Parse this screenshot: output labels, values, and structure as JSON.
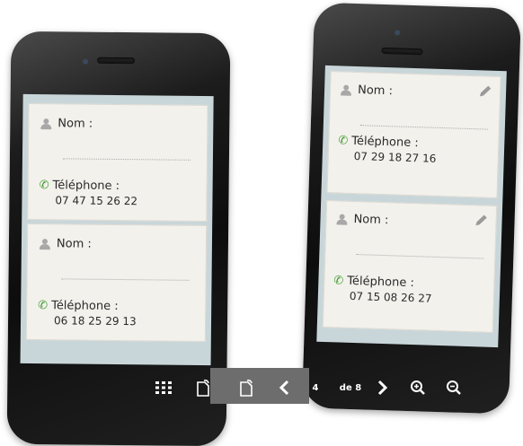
{
  "contacts_left": [
    {
      "name_label": "Nom :",
      "phone_label": "Téléphone :",
      "phone": "07 47 15 26 22"
    },
    {
      "name_label": "Nom :",
      "phone_label": "Téléphone :",
      "phone": "06 18 25 29 13"
    }
  ],
  "contacts_right": [
    {
      "name_label": "Nom :",
      "phone_label": "Téléphone :",
      "phone": "07 29 18 27 16"
    },
    {
      "name_label": "Nom :",
      "phone_label": "Téléphone :",
      "phone": "07 15 08 26 27"
    }
  ],
  "toolbar": {
    "page_current": "4",
    "page_of": "de 8",
    "icons": [
      "grid-icon",
      "page-turn-icon",
      "page-turn-icon",
      "chevron-left-icon",
      "chevron-right-icon",
      "zoom-in-icon",
      "zoom-out-icon"
    ]
  },
  "colors": {
    "screen_bg": "#c9d6d9",
    "card_bg": "#f3f1ec",
    "phone_icon": "#3d9a2e",
    "toolbar_bg": "#6d6d6d"
  }
}
